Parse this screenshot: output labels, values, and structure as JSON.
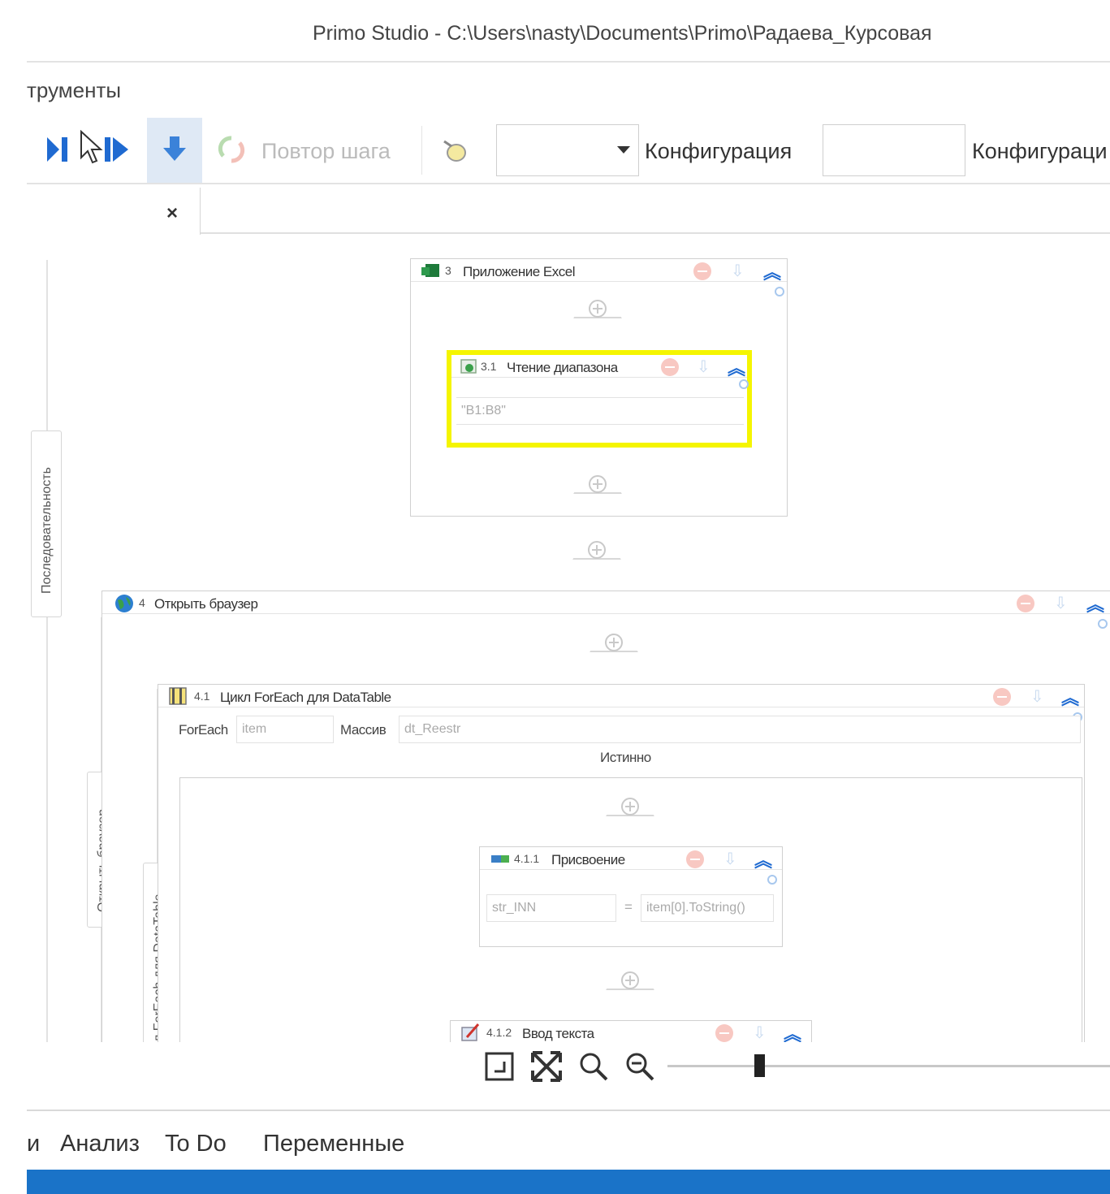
{
  "window": {
    "title": "Primo Studio - C:\\Users\\nasty\\Documents\\Primo\\Радаева_Курсовая"
  },
  "ribbon": {
    "tab_label": "трументы"
  },
  "toolbar": {
    "repeat_step_label": "Повтор шага",
    "config_label_1": "Конфигурация",
    "config_label_2": "Конфигураци",
    "config_combo_value": "",
    "config_field_value": ""
  },
  "doc_tab": {
    "close_glyph": "×"
  },
  "workflow": {
    "excel_app": {
      "num": "3",
      "title": "Приложение Excel"
    },
    "read_range": {
      "num": "3.1",
      "title": "Чтение диапазона",
      "range": "\"B1:B8\""
    },
    "open_browser": {
      "num": "4",
      "title": "Открыть браузер"
    },
    "foreach": {
      "num": "4.1",
      "title": "Цикл ForEach для DataTable",
      "foreach_label": "ForEach",
      "item_value": "item",
      "array_label": "Массив",
      "array_value": "dt_Reestr",
      "true_label": "Истинно"
    },
    "assign": {
      "num": "4.1.1",
      "title": "Присвоение",
      "left": "str_INN",
      "eq": "=",
      "right": "item[0].ToString()"
    },
    "type_text": {
      "num": "4.1.2",
      "title": "Ввод текста"
    },
    "side_labels": {
      "sequence": "Последовательность",
      "open_browser": "Открыть браузер",
      "foreach": "л ForEach для DataTable"
    }
  },
  "bottom_tabs": {
    "cut": "и",
    "analysis": "Анализ",
    "todo": "To Do",
    "variables": "Переменные"
  },
  "colors": {
    "accent": "#1f6ad1",
    "selection": "#ffff00",
    "statusbar": "#1a73c8"
  },
  "icons": [
    "play-icon",
    "cursor-icon",
    "step-over-icon",
    "step-into-icon",
    "repeat-step-icon",
    "highlight-icon",
    "fit-screen-icon",
    "fullscreen-icon",
    "zoom-in-icon",
    "zoom-out-icon",
    "excel-icon",
    "read-range-icon",
    "globe-icon",
    "foreach-icon",
    "assign-icon",
    "type-text-icon"
  ]
}
